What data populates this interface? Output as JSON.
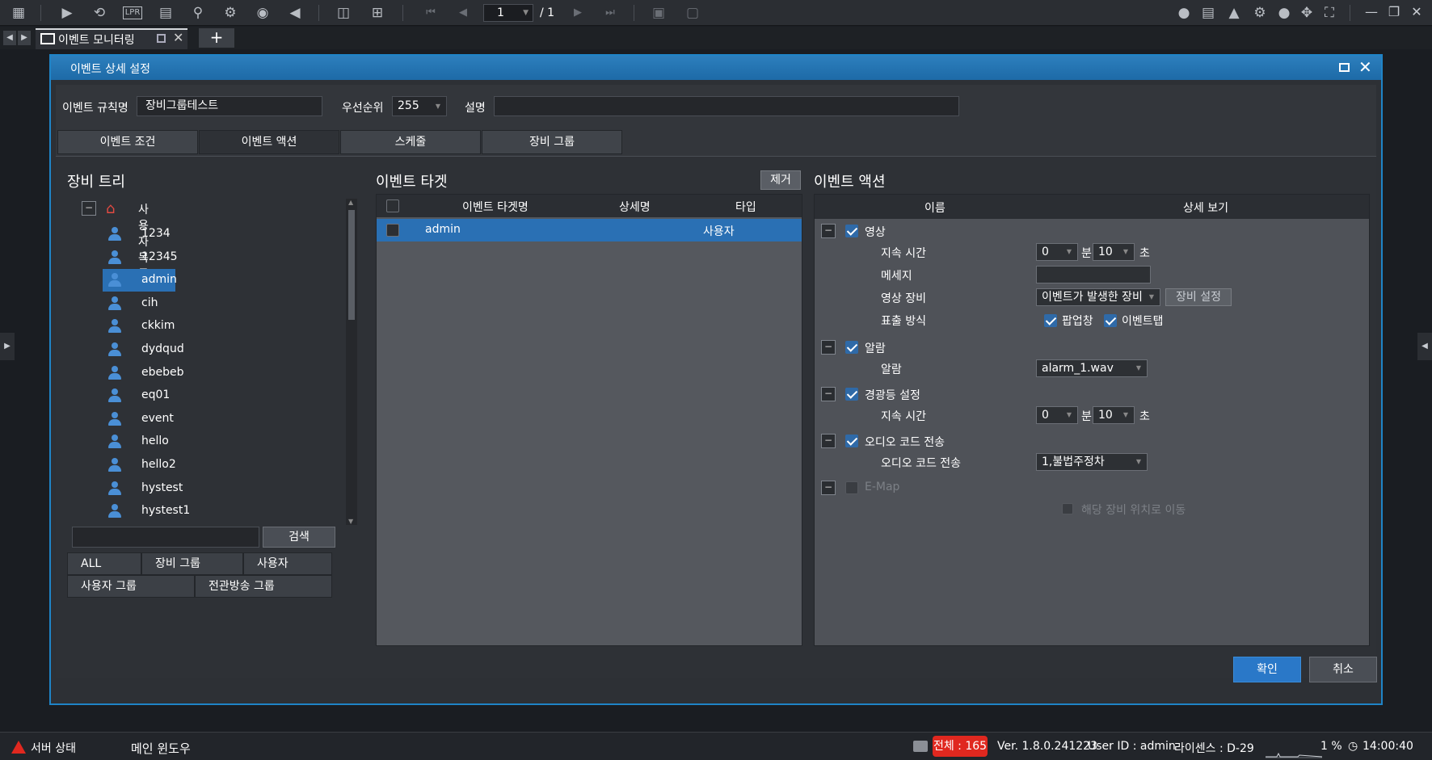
{
  "toolbar": {
    "icons": [
      "grid-icon",
      "play-icon",
      "playback-search-icon",
      "lpr-icon",
      "layout-icon",
      "search-person-icon",
      "bike-icon",
      "map-pin-icon",
      "speaker-icon",
      "split-view-icon",
      "add-screen-icon",
      "first-page-icon",
      "prev-page-icon",
      "next-page-icon",
      "last-page-icon",
      "record-icon",
      "snapshot-icon",
      "chat-icon",
      "message-icon",
      "alarm-icon",
      "settings-icon",
      "user-icon",
      "move-icon",
      "fullscreen-icon"
    ],
    "lpr_label": "LPR",
    "page_current": "1",
    "page_total": "/ 1"
  },
  "tabbar": {
    "tab_label": "이벤트 모니터링",
    "add_label": "+"
  },
  "dialog": {
    "title": "이벤트 상세 설정",
    "rule_name_label": "이벤트 규칙명",
    "rule_name_value": "장비그룹테스트",
    "priority_label": "우선순위",
    "priority_value": "255",
    "description_label": "설명",
    "description_value": "",
    "tabs": [
      "이벤트 조건",
      "이벤트 액션",
      "스케줄",
      "장비 그룹"
    ],
    "ok_label": "확인",
    "cancel_label": "취소"
  },
  "device_tree": {
    "title": "장비 트리",
    "root_label": "사용자 목록",
    "items": [
      "1234",
      "12345",
      "admin",
      "cih",
      "ckkim",
      "dydqud",
      "ebebeb",
      "eq01",
      "event",
      "hello",
      "hello2",
      "hystest",
      "hystest1"
    ],
    "selected": "admin",
    "search_label": "검색",
    "filters": [
      "ALL",
      "장비 그룹",
      "사용자",
      "사용자 그룹",
      "전관방송 그룹"
    ]
  },
  "event_target": {
    "title": "이벤트 타겟",
    "remove_label": "제거",
    "columns": [
      "이벤트 타겟명",
      "상세명",
      "타입"
    ],
    "rows": [
      {
        "name": "admin",
        "detail": "",
        "type": "사용자"
      }
    ]
  },
  "event_action": {
    "title": "이벤트 액션",
    "columns": [
      "이름",
      "상세 보기"
    ],
    "video": {
      "label": "영상",
      "duration_label": "지속 시간",
      "minutes": "0",
      "min_unit": "분",
      "seconds": "10",
      "sec_unit": "초",
      "message_label": "메세지",
      "message_value": "",
      "device_label": "영상 장비",
      "device_value": "이벤트가 발생한 장비",
      "device_setting_label": "장비 설정",
      "display_label": "표출 방식",
      "popup_label": "팝업창",
      "event_tab_label": "이벤트탭"
    },
    "alarm": {
      "label": "알람",
      "sub_label": "알람",
      "value": "alarm_1.wav"
    },
    "warning_light": {
      "label": "경광등 설정",
      "duration_label": "지속 시간",
      "minutes": "0",
      "min_unit": "분",
      "seconds": "10",
      "sec_unit": "초"
    },
    "audio_code": {
      "label": "오디오 코드 전송",
      "sub_label": "오디오 코드 전송",
      "value": "1,불법주정차"
    },
    "emap": {
      "label": "E-Map",
      "move_label": "해당 장비 위치로 이동"
    }
  },
  "statusbar": {
    "server_status": "서버 상태",
    "main_window": "메인 윈도우",
    "total": "전체 : 165",
    "version": "Ver. 1.8.0.241223",
    "user_id": "User ID : admin",
    "license": "라이센스 : D-29",
    "cpu": "1 %",
    "time": "14:00:40"
  },
  "colors": {
    "accent": "#2a70b4",
    "title_bar": "#1d6aa7",
    "alert": "#e0281f"
  }
}
